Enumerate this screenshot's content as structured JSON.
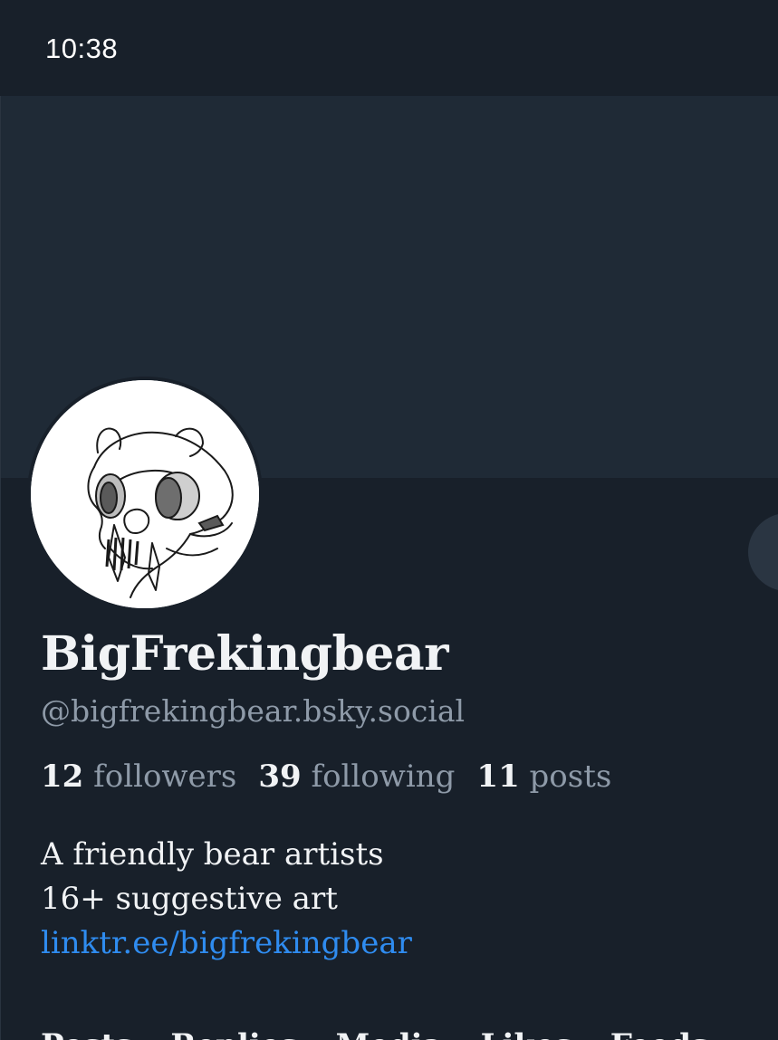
{
  "status_bar": {
    "time": "10:38"
  },
  "profile": {
    "display_name": "BigFrekingbear",
    "handle": "@bigfrekingbear.bsky.social",
    "stats": {
      "followers_count": "12",
      "followers_label": "followers",
      "following_count": "39",
      "following_label": "following",
      "posts_count": "11",
      "posts_label": "posts"
    },
    "bio": {
      "line1": "A friendly bear artists",
      "line2": "16+ suggestive art",
      "link": "linktr.ee/bigfrekingbear"
    }
  },
  "tabs": [
    "Posts",
    "Replies",
    "Media",
    "Likes",
    "Feeds"
  ],
  "colors": {
    "background": "#18202a",
    "banner": "#1f2a36",
    "text_primary": "#f1f3f5",
    "text_secondary": "#8e9aa8",
    "link": "#2f8cf0"
  }
}
